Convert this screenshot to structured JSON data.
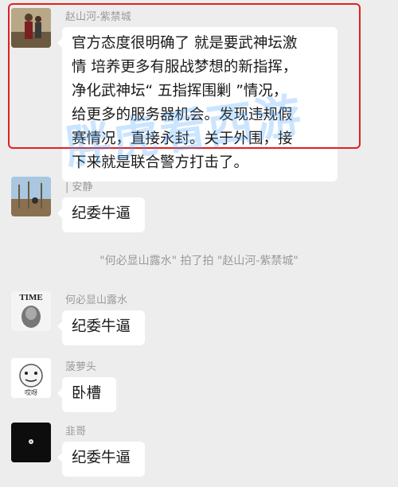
{
  "messages": [
    {
      "name": "赵山河-紫禁城",
      "lines": [
        "官方态度很明确了 就是要武神坛激",
        "情 培养更多有服战梦想的新指挥，",
        "净化武神坛“ 五指挥围剿 ”情况，",
        "给更多的服务器机会。发现违规假",
        "赛情况，直接永封。关于外围，接",
        "下来就是联合警方打击了。"
      ]
    },
    {
      "name": "| 安静",
      "text": "纪委牛逼"
    },
    {
      "name": "何必显山露水",
      "avatar_text": "TIME",
      "text": "纪委牛逼"
    },
    {
      "name": "菠萝头",
      "avatar_text": "哎呀",
      "text": "卧槽"
    },
    {
      "name": "韭哥",
      "text": "纪委牛逼"
    }
  ],
  "system_message": "\"何必显山露水\" 拍了拍 \"赵山河-紫禁城\"",
  "watermark": "胖虎看西游",
  "colors": {
    "highlight_border": "#e02020",
    "watermark": "#4aa3ff"
  }
}
